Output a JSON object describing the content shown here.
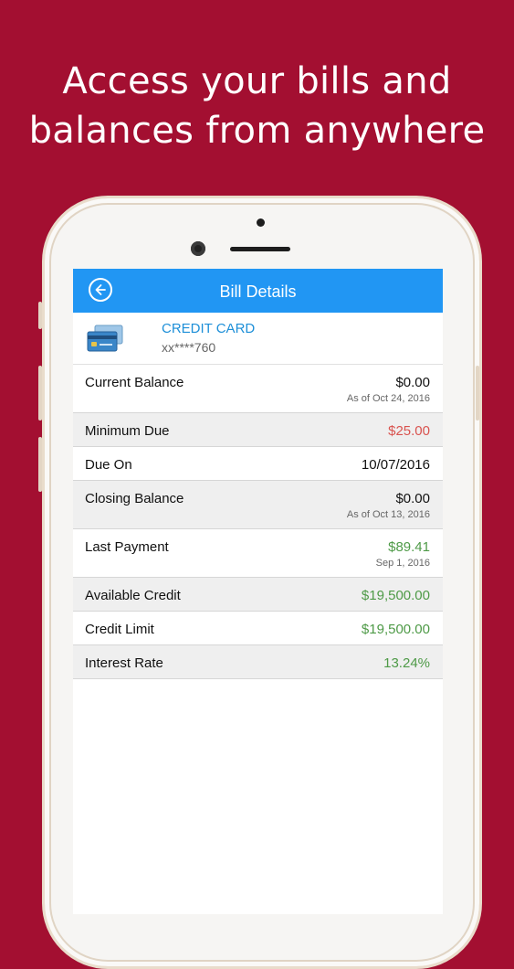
{
  "headline": {
    "line1": "Access your bills and",
    "line2": "balances from anywhere"
  },
  "colors": {
    "background": "#a30f31",
    "nav": "#2196f3",
    "card_name": "#1d8fd8",
    "due_red": "#d9534f",
    "credit_green": "#4e9a47"
  },
  "screen": {
    "nav": {
      "title": "Bill Details",
      "back_icon": "back-arrow-icon"
    },
    "card": {
      "icon": "credit-card-icon",
      "name": "CREDIT CARD",
      "number": "xx****760"
    },
    "rows": {
      "current_balance": {
        "label": "Current Balance",
        "value": "$0.00",
        "sub": "As of Oct 24, 2016"
      },
      "minimum_due": {
        "label": "Minimum Due",
        "value": "$25.00"
      },
      "due_on": {
        "label": "Due On",
        "value": "10/07/2016"
      },
      "closing_balance": {
        "label": "Closing Balance",
        "value": "$0.00",
        "sub": "As of Oct 13, 2016"
      },
      "last_payment": {
        "label": "Last Payment",
        "value": "$89.41",
        "sub": "Sep 1, 2016"
      },
      "available_credit": {
        "label": "Available Credit",
        "value": "$19,500.00"
      },
      "credit_limit": {
        "label": "Credit Limit",
        "value": "$19,500.00"
      },
      "interest_rate": {
        "label": "Interest Rate",
        "value": "13.24%"
      }
    }
  }
}
